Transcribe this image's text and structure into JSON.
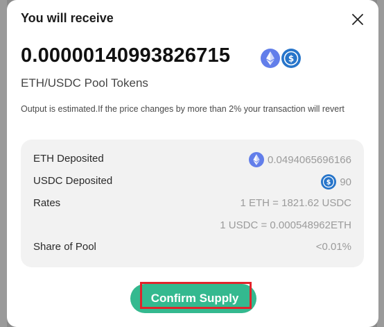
{
  "modal": {
    "title": "You will receive",
    "amount": "0.00000140993826715",
    "pool_tokens_label": "ETH/USDC Pool Tokens",
    "note": "Output is estimated.If the price changes by more than 2% your transaction will revert"
  },
  "details": {
    "eth_deposited_label": "ETH Deposited",
    "eth_deposited_value": "0.0494065696166",
    "usdc_deposited_label": "USDC Deposited",
    "usdc_deposited_value": "90",
    "rates_label": "Rates",
    "rate_eth_usdc": "1 ETH = 1821.62 USDC",
    "rate_usdc_eth": "1 USDC = 0.000548962ETH",
    "share_label": "Share of Pool",
    "share_value": "<0.01%"
  },
  "actions": {
    "confirm_label": "Confirm Supply"
  },
  "icons": {
    "close": "close-icon",
    "eth": "eth-token-icon",
    "usdc": "usdc-token-icon"
  },
  "colors": {
    "eth": "#627eea",
    "usdc": "#2775ca",
    "confirm": "#34b98f",
    "highlight": "#e2232b",
    "panel": "#f2f2f2"
  }
}
